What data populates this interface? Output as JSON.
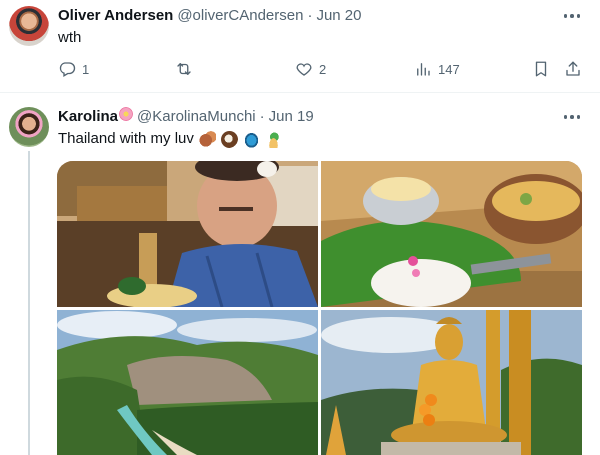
{
  "tweets": [
    {
      "name": "Oliver Andersen",
      "handle": "@oliverCAndersen",
      "separator": "·",
      "date": "Jun 20",
      "text": "wth",
      "stats": {
        "replies": "1",
        "retweets": "",
        "likes": "2",
        "views": "147"
      }
    },
    {
      "name": "Karolina",
      "handle": "@KarolinaMunchi",
      "separator": "·",
      "date": "Jun 19",
      "text": "Thailand with my luv"
    }
  ],
  "icons": {
    "more": "more-dots-icon",
    "reply": "reply-icon",
    "retweet": "retweet-icon",
    "like": "heart-icon",
    "views": "views-bar-icon",
    "bookmark": "bookmark-icon",
    "share": "share-icon"
  },
  "colors": {
    "text": "#0f1419",
    "secondary": "#536471",
    "divider": "#eff3f4",
    "thread_line": "#cfd9de"
  }
}
